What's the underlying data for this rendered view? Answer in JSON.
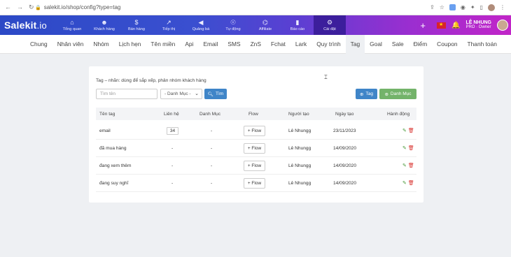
{
  "browser": {
    "url": "salekit.io/shop/config?type=tag",
    "back_icon": "back-arrow-icon",
    "forward_icon": "forward-arrow-icon",
    "reload_icon": "reload-icon"
  },
  "app": {
    "logo_main": "Salekit",
    "logo_suffix": ".io",
    "menu": [
      {
        "label": "Tổng quan",
        "icon": "home-icon"
      },
      {
        "label": "Khách hàng",
        "icon": "users-icon"
      },
      {
        "label": "Bán hàng",
        "icon": "dollar-icon"
      },
      {
        "label": "Tiếp thị",
        "icon": "chart-line-icon"
      },
      {
        "label": "Quảng bá",
        "icon": "megaphone-icon"
      },
      {
        "label": "Tự động",
        "icon": "robot-icon"
      },
      {
        "label": "Affiliate",
        "icon": "network-icon"
      },
      {
        "label": "Báo cáo",
        "icon": "bar-chart-icon"
      },
      {
        "label": "Cài đặt",
        "icon": "gear-icon"
      }
    ],
    "user_name": "LÊ NHUNG",
    "user_role": "PRO · Owner"
  },
  "subnav": [
    "Chung",
    "Nhân viên",
    "Nhóm",
    "Lịch hẹn",
    "Tên miền",
    "Api",
    "Email",
    "SMS",
    "ZnS",
    "Fchat",
    "Lark",
    "Quy trình",
    "Tag",
    "Goal",
    "Sale",
    "Điểm",
    "Coupon",
    "Thanh toán"
  ],
  "active_tab": "Tag",
  "content": {
    "description": "Tag – nhãn: dùng để sắp xếp, phân nhóm khách hàng",
    "search_placeholder": "Tìm tên",
    "category_select": "- Danh Mục -",
    "find_button": "Tìm",
    "add_tag_button": "Tag",
    "add_category_button": "Danh Mục",
    "columns": [
      "Tên tag",
      "Liên hệ",
      "Danh Mục",
      "Flow",
      "Người tạo",
      "Ngày tạo",
      "Hành động"
    ],
    "rows": [
      {
        "name": "email",
        "contacts": "34",
        "category": "-",
        "flow": "+ Flow",
        "creator": "Lê Nhungg",
        "date": "23/11/2023"
      },
      {
        "name": "đã mua hàng",
        "contacts": "-",
        "category": "-",
        "flow": "+ Flow",
        "creator": "Lê Nhungg",
        "date": "14/09/2020"
      },
      {
        "name": "đang xem thêm",
        "contacts": "-",
        "category": "-",
        "flow": "+ Flow",
        "creator": "Lê Nhungg",
        "date": "14/09/2020"
      },
      {
        "name": "đang suy nghĩ",
        "contacts": "-",
        "category": "-",
        "flow": "+ Flow",
        "creator": "Lê Nhungg",
        "date": "14/09/2020"
      }
    ]
  },
  "colors": {
    "topbar_start": "#2c49c6",
    "topbar_end": "#c125c8",
    "primary_button": "#3f85c8",
    "success_button": "#73b36a"
  }
}
